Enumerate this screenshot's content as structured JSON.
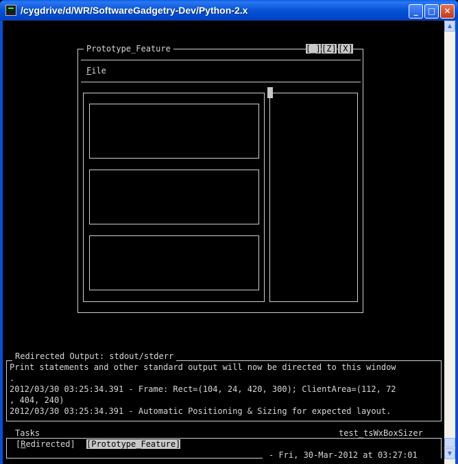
{
  "window": {
    "title": "/cygdrive/d/WR/SoftwareGadgetry-Dev/Python-2.x"
  },
  "frame": {
    "title": "Prototype_Feature",
    "buttons": [
      "[_]",
      "[Z]",
      "[X]"
    ],
    "menu": {
      "file_hotkey": "F",
      "file_rest": "ile"
    }
  },
  "output": {
    "title": "Redirected Output: stdout/stderr",
    "lines": [
      "Print statements and other standard output will now be directed to this window",
      ".",
      "2012/03/30 03:25:34.391 - Frame: Rect=(104, 24, 420, 300); ClientArea=(112, 72",
      ", 404, 240)",
      "2012/03/30 03:25:34.391 - Automatic Positioning & Sizing for expected layout."
    ]
  },
  "tasks": {
    "title": "Tasks",
    "app_name": "test_tsWxBoxSizer",
    "items": [
      {
        "prefix": "[",
        "hotkey": "R",
        "rest": "edirected]"
      },
      {
        "label": "[Prototype_Feature]"
      }
    ],
    "status": "- Fri, 30-Mar-2012 at 03:27:01"
  },
  "icons": {
    "minimize": "minimize-icon",
    "maximize": "maximize-icon",
    "close": "close-icon",
    "scroll_up": "scroll-up-arrow-icon",
    "scroll_down": "scroll-down-arrow-icon"
  },
  "colors": {
    "titlebar": "#0552d6",
    "terminal_bg": "#000000",
    "terminal_fg": "#d8d8d8",
    "highlight": "#c8c8c8"
  }
}
